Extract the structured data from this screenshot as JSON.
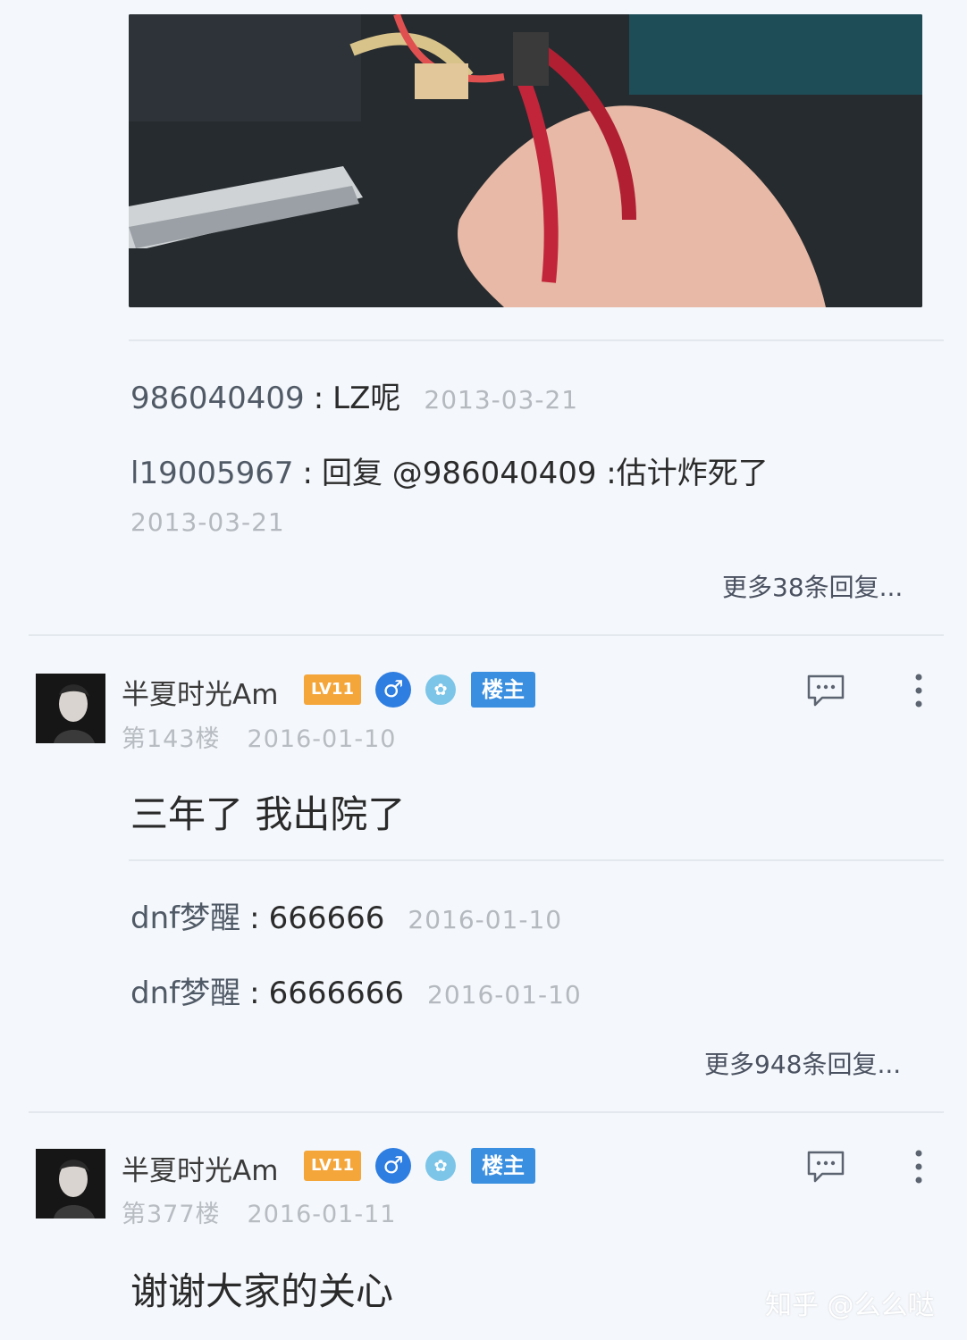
{
  "top_thread": {
    "replies": [
      {
        "user": "986040409",
        "text": "LZ呢",
        "date": "2013-03-21"
      },
      {
        "user": "l19005967",
        "text": "回复 @986040409 :估计炸死了",
        "date": "2013-03-21"
      }
    ],
    "more_label": "更多38条回复..."
  },
  "posts": [
    {
      "username": "半夏时光Am",
      "level_badge": "LV11",
      "gender_icon": "♂",
      "host_badge": "楼主",
      "floor": "第143楼",
      "date": "2016-01-10",
      "body": "三年了 我出院了",
      "replies": [
        {
          "user": "dnf梦醒",
          "text": "666666",
          "date": "2016-01-10"
        },
        {
          "user": "dnf梦醒",
          "text": "6666666",
          "date": "2016-01-10"
        }
      ],
      "more_label": "更多948条回复..."
    },
    {
      "username": "半夏时光Am",
      "level_badge": "LV11",
      "gender_icon": "♂",
      "host_badge": "楼主",
      "floor": "第377楼",
      "date": "2016-01-11",
      "body": "谢谢大家的关心"
    }
  ],
  "icons": {
    "comment": "comment-icon",
    "more": "more-vertical-icon",
    "medal": "medal-icon"
  },
  "colors": {
    "background": "#f4f7fb",
    "level_badge": "#f5a63a",
    "gender_badge": "#2e7de0",
    "host_badge": "#3a8fe0",
    "muted_text": "#b4b9bf"
  },
  "watermark": "知乎 @么么哒"
}
